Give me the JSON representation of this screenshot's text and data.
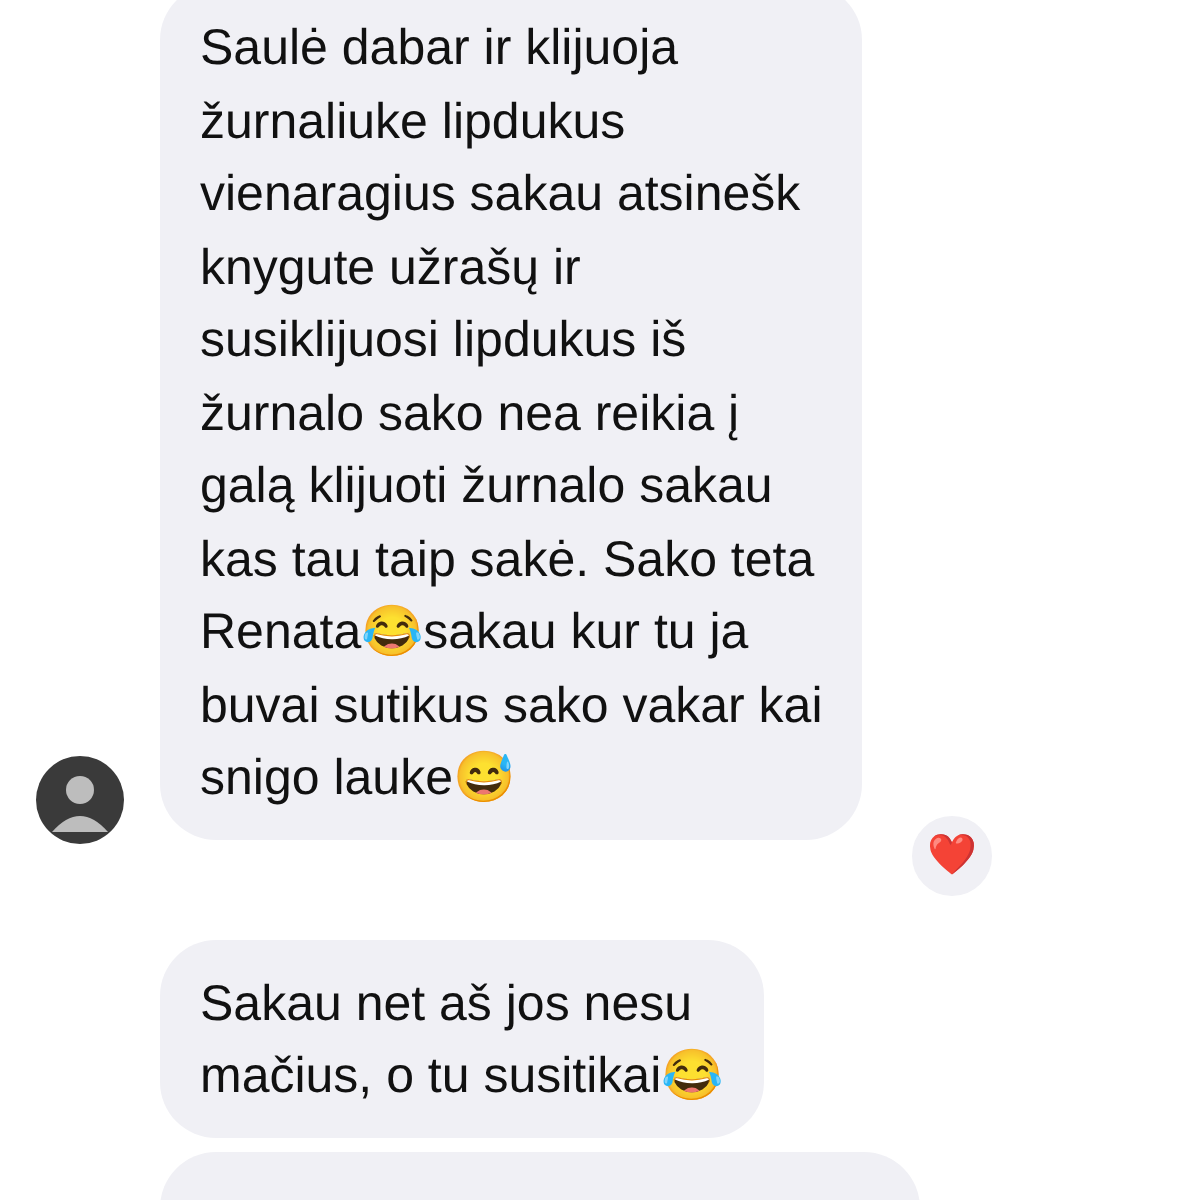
{
  "messages": [
    {
      "kind": "text",
      "avatar": true,
      "reaction": "❤️",
      "lines": [
        "Saulė dabar ir klijuoja",
        "žurnaliuke lipdukus",
        "vienaragius sakau atsinešk",
        "knygute užrašų ir",
        "susiklijuosi lipdukus iš",
        "žurnalo sako nea reikia į",
        "galą klijuoti žurnalo sakau",
        "kas tau taip sakė. Sako teta",
        "Renata😂sakau kur tu ja",
        "buvai sutikus sako vakar kai",
        "snigo lauke😅"
      ]
    },
    {
      "kind": "text",
      "avatar": false,
      "lines": [
        "Sakau net aš jos nesu",
        "mačius, o tu susitikai😂"
      ]
    },
    {
      "kind": "cut",
      "avatar": false
    }
  ]
}
